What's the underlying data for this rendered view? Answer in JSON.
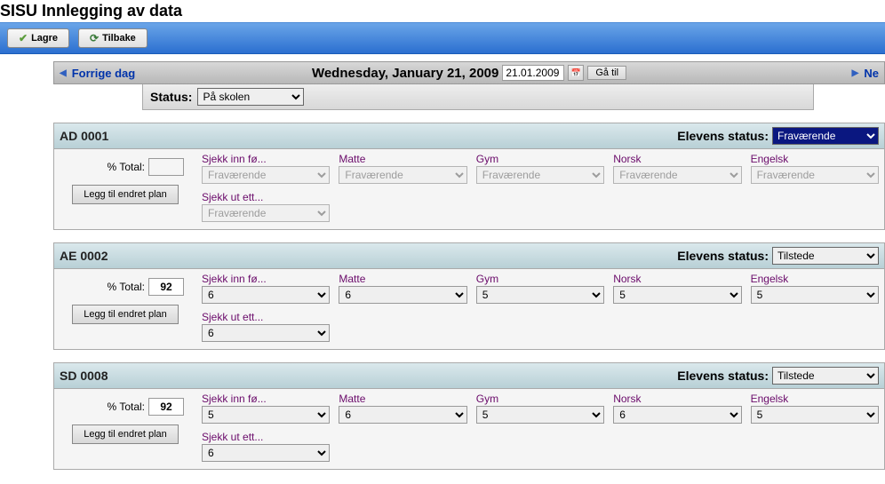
{
  "page_title": "SISU Innlegging av data",
  "toolbar": {
    "save_label": "Lagre",
    "back_label": "Tilbake"
  },
  "datebar": {
    "prev_label": "Forrige dag",
    "date_long": "Wednesday, January 21, 2009",
    "date_value": "21.01.2009",
    "goto_label": "Gå til",
    "next_label": "Ne"
  },
  "status": {
    "label": "Status:",
    "value": "På skolen"
  },
  "elevens_status_label": "Elevens status:",
  "total_label": "% Total:",
  "change_plan_label": "Legg til endret plan",
  "subjects": {
    "checkin": "Sjekk inn fø...",
    "matte": "Matte",
    "gym": "Gym",
    "norsk": "Norsk",
    "engelsk": "Engelsk",
    "checkout": "Sjekk ut ett..."
  },
  "students": [
    {
      "id": "AD 0001",
      "status": "Fraværende",
      "status_dark": true,
      "total": "",
      "disabled": true,
      "grades": {
        "checkin": "Fraværende",
        "matte": "Fraværende",
        "gym": "Fraværende",
        "norsk": "Fraværende",
        "engelsk": "Fraværende",
        "checkout": "Fraværende"
      }
    },
    {
      "id": "AE 0002",
      "status": "Tilstede",
      "status_dark": false,
      "total": "92",
      "disabled": false,
      "grades": {
        "checkin": "6",
        "matte": "6",
        "gym": "5",
        "norsk": "5",
        "engelsk": "5",
        "checkout": "6"
      }
    },
    {
      "id": "SD 0008",
      "status": "Tilstede",
      "status_dark": false,
      "total": "92",
      "disabled": false,
      "grades": {
        "checkin": "5",
        "matte": "6",
        "gym": "5",
        "norsk": "6",
        "engelsk": "5",
        "checkout": "6"
      }
    }
  ]
}
